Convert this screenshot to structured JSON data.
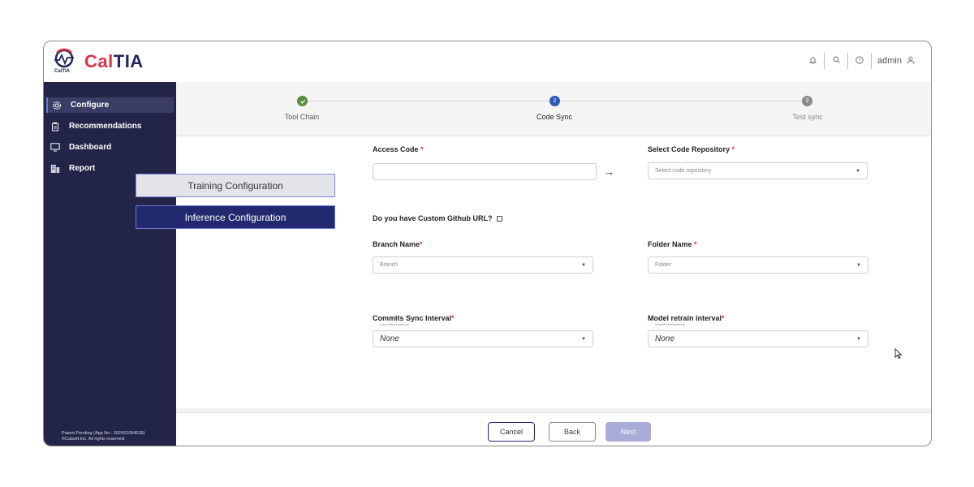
{
  "app": {
    "logo_prefix": "Cal",
    "logo_suffix": "TIA",
    "logo_caption": "CalTIA",
    "brand_colors": {
      "red": "#d6334a",
      "navy": "#22285c"
    }
  },
  "header": {
    "icons": [
      "bell-icon",
      "search-icon",
      "help-icon"
    ],
    "user_label": "admin"
  },
  "sidebar": {
    "items": [
      {
        "label": "Configure",
        "icon": "gear-icon",
        "active": true
      },
      {
        "label": "Recommendations",
        "icon": "clipboard-icon",
        "active": false
      },
      {
        "label": "Dashboard",
        "icon": "monitor-icon",
        "active": false
      },
      {
        "label": "Report",
        "icon": "report-icon",
        "active": false
      }
    ],
    "footer_line1": "Patent Pending (App No : 202421064035)",
    "footer_line2": "©Calsoft.Inc. All rights reserved."
  },
  "submenu": {
    "items": [
      {
        "label": "Training Configuration"
      },
      {
        "label": "Inference Configuration"
      }
    ]
  },
  "stepper": {
    "steps": [
      {
        "number": "",
        "label": "Tool Chain",
        "status": "complete",
        "color": "#5a8f3c"
      },
      {
        "number": "2",
        "label": "Code Sync",
        "status": "active",
        "color": "#2e58b8"
      },
      {
        "number": "3",
        "label": "Test sync",
        "status": "pending",
        "color": "#8a8a8a"
      }
    ]
  },
  "form": {
    "access_code": {
      "label": "Access Code",
      "required": "*",
      "value": ""
    },
    "repo": {
      "label": "Select Code Repository",
      "required": "*",
      "placeholder": "Select code repository"
    },
    "custom_url": {
      "label": "Do you have Custom Github URL?",
      "checked": false
    },
    "branch": {
      "label": "Branch Name",
      "required": "*",
      "placeholder": "Branch"
    },
    "folder": {
      "label": "Folder Name",
      "required": "*",
      "placeholder": "Folder"
    },
    "commit_interval": {
      "label": "Commits Sync Interval",
      "required": "*",
      "sublabel": "CommitSyncInterval",
      "value": "None"
    },
    "retrain_interval": {
      "label": "Model retrain interval",
      "required": "*",
      "sublabel": "ModelRetrainInterval",
      "value": "None"
    }
  },
  "footer": {
    "cancel_label": "Cancel",
    "back_label": "Back",
    "next_label": "Next"
  }
}
